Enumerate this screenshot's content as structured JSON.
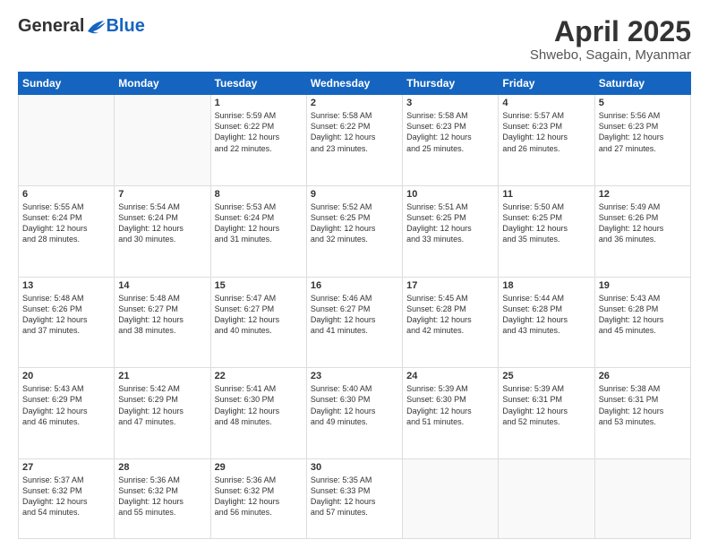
{
  "logo": {
    "general": "General",
    "blue": "Blue"
  },
  "title": "April 2025",
  "subtitle": "Shwebo, Sagain, Myanmar",
  "days": [
    "Sunday",
    "Monday",
    "Tuesday",
    "Wednesday",
    "Thursday",
    "Friday",
    "Saturday"
  ],
  "weeks": [
    [
      {
        "day": "",
        "content": ""
      },
      {
        "day": "",
        "content": ""
      },
      {
        "day": "1",
        "content": "Sunrise: 5:59 AM\nSunset: 6:22 PM\nDaylight: 12 hours\nand 22 minutes."
      },
      {
        "day": "2",
        "content": "Sunrise: 5:58 AM\nSunset: 6:22 PM\nDaylight: 12 hours\nand 23 minutes."
      },
      {
        "day": "3",
        "content": "Sunrise: 5:58 AM\nSunset: 6:23 PM\nDaylight: 12 hours\nand 25 minutes."
      },
      {
        "day": "4",
        "content": "Sunrise: 5:57 AM\nSunset: 6:23 PM\nDaylight: 12 hours\nand 26 minutes."
      },
      {
        "day": "5",
        "content": "Sunrise: 5:56 AM\nSunset: 6:23 PM\nDaylight: 12 hours\nand 27 minutes."
      }
    ],
    [
      {
        "day": "6",
        "content": "Sunrise: 5:55 AM\nSunset: 6:24 PM\nDaylight: 12 hours\nand 28 minutes."
      },
      {
        "day": "7",
        "content": "Sunrise: 5:54 AM\nSunset: 6:24 PM\nDaylight: 12 hours\nand 30 minutes."
      },
      {
        "day": "8",
        "content": "Sunrise: 5:53 AM\nSunset: 6:24 PM\nDaylight: 12 hours\nand 31 minutes."
      },
      {
        "day": "9",
        "content": "Sunrise: 5:52 AM\nSunset: 6:25 PM\nDaylight: 12 hours\nand 32 minutes."
      },
      {
        "day": "10",
        "content": "Sunrise: 5:51 AM\nSunset: 6:25 PM\nDaylight: 12 hours\nand 33 minutes."
      },
      {
        "day": "11",
        "content": "Sunrise: 5:50 AM\nSunset: 6:25 PM\nDaylight: 12 hours\nand 35 minutes."
      },
      {
        "day": "12",
        "content": "Sunrise: 5:49 AM\nSunset: 6:26 PM\nDaylight: 12 hours\nand 36 minutes."
      }
    ],
    [
      {
        "day": "13",
        "content": "Sunrise: 5:48 AM\nSunset: 6:26 PM\nDaylight: 12 hours\nand 37 minutes."
      },
      {
        "day": "14",
        "content": "Sunrise: 5:48 AM\nSunset: 6:27 PM\nDaylight: 12 hours\nand 38 minutes."
      },
      {
        "day": "15",
        "content": "Sunrise: 5:47 AM\nSunset: 6:27 PM\nDaylight: 12 hours\nand 40 minutes."
      },
      {
        "day": "16",
        "content": "Sunrise: 5:46 AM\nSunset: 6:27 PM\nDaylight: 12 hours\nand 41 minutes."
      },
      {
        "day": "17",
        "content": "Sunrise: 5:45 AM\nSunset: 6:28 PM\nDaylight: 12 hours\nand 42 minutes."
      },
      {
        "day": "18",
        "content": "Sunrise: 5:44 AM\nSunset: 6:28 PM\nDaylight: 12 hours\nand 43 minutes."
      },
      {
        "day": "19",
        "content": "Sunrise: 5:43 AM\nSunset: 6:28 PM\nDaylight: 12 hours\nand 45 minutes."
      }
    ],
    [
      {
        "day": "20",
        "content": "Sunrise: 5:43 AM\nSunset: 6:29 PM\nDaylight: 12 hours\nand 46 minutes."
      },
      {
        "day": "21",
        "content": "Sunrise: 5:42 AM\nSunset: 6:29 PM\nDaylight: 12 hours\nand 47 minutes."
      },
      {
        "day": "22",
        "content": "Sunrise: 5:41 AM\nSunset: 6:30 PM\nDaylight: 12 hours\nand 48 minutes."
      },
      {
        "day": "23",
        "content": "Sunrise: 5:40 AM\nSunset: 6:30 PM\nDaylight: 12 hours\nand 49 minutes."
      },
      {
        "day": "24",
        "content": "Sunrise: 5:39 AM\nSunset: 6:30 PM\nDaylight: 12 hours\nand 51 minutes."
      },
      {
        "day": "25",
        "content": "Sunrise: 5:39 AM\nSunset: 6:31 PM\nDaylight: 12 hours\nand 52 minutes."
      },
      {
        "day": "26",
        "content": "Sunrise: 5:38 AM\nSunset: 6:31 PM\nDaylight: 12 hours\nand 53 minutes."
      }
    ],
    [
      {
        "day": "27",
        "content": "Sunrise: 5:37 AM\nSunset: 6:32 PM\nDaylight: 12 hours\nand 54 minutes."
      },
      {
        "day": "28",
        "content": "Sunrise: 5:36 AM\nSunset: 6:32 PM\nDaylight: 12 hours\nand 55 minutes."
      },
      {
        "day": "29",
        "content": "Sunrise: 5:36 AM\nSunset: 6:32 PM\nDaylight: 12 hours\nand 56 minutes."
      },
      {
        "day": "30",
        "content": "Sunrise: 5:35 AM\nSunset: 6:33 PM\nDaylight: 12 hours\nand 57 minutes."
      },
      {
        "day": "",
        "content": ""
      },
      {
        "day": "",
        "content": ""
      },
      {
        "day": "",
        "content": ""
      }
    ]
  ]
}
